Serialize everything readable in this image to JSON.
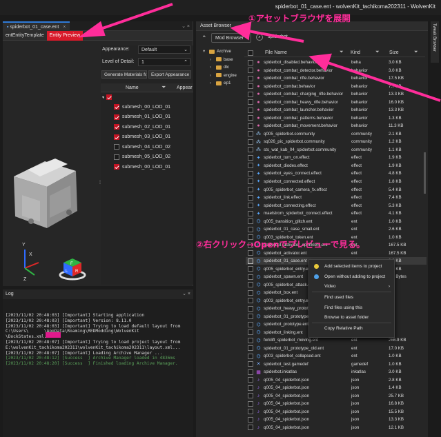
{
  "window": {
    "title": "spiderbot_01_case.ent - wolvenKit_tachikoma202311 - WolvenKit"
  },
  "left_panel": {
    "doc_tab": "spiderbot_01_case.ent",
    "subtabs": [
      "entEntityTemplate",
      "Entity Preview"
    ],
    "add_tab": "+",
    "appearance_label": "Appearance:",
    "appearance_value": "Default",
    "lod_label": "Level of Detail:",
    "lod_value": "1",
    "gen_button": "Generate Materials fo",
    "export_button": "Export Appearance w",
    "col_name": "Name",
    "col_appear": "Appear",
    "meshes": [
      {
        "name": "submesh_00_LOD_01",
        "checked": true
      },
      {
        "name": "submesh_01_LOD_01",
        "checked": true
      },
      {
        "name": "submesh_02_LOD_01",
        "checked": true
      },
      {
        "name": "submesh_03_LOD_01",
        "checked": true
      },
      {
        "name": "submesh_04_LOD_02",
        "checked": false
      },
      {
        "name": "submesh_05_LOD_02",
        "checked": false
      },
      {
        "name": "submesh_00_LOD_01",
        "checked": true
      }
    ],
    "axes": {
      "y": "Y",
      "x": "X",
      "z": "Z"
    },
    "gizmo_letters": [
      "L",
      "R",
      "F"
    ]
  },
  "log": {
    "title": "Log",
    "lines": [
      {
        "t": "[2023/11/02 20:48:03] [Important] Starting application",
        "green": false
      },
      {
        "t": "[2023/11/02 20:48:03] [Important] Version: 8.11.0",
        "green": false
      },
      {
        "t": "[2023/11/02 20:48:03] [Important] Trying to load default layout from",
        "green": false
      },
      {
        "t": "C:\\Users\\      \\AppData\\Roaming\\REDModding\\WolvenKit",
        "green": false
      },
      {
        "t": "\\DockStates.xml...",
        "green": false
      },
      {
        "t": "[2023/11/02 20:48:07] [Important] Trying to load project layout from",
        "green": false
      },
      {
        "t": "E:\\wolvenKit_tachikoma202311\\wolvenKit_tachikoma202311\\layout.xml...",
        "green": false
      },
      {
        "t": "[2023/11/02 20:48:07] [Important] Loading Archive Manager ...",
        "green": false
      },
      {
        "t": "[2023/11/02 20:48:12] [Success  ] Archive Manager loaded in 4836ms",
        "green": true
      },
      {
        "t": "[2023/11/02 20:48:20] [Success  ] Finished loading Archive Manager.",
        "green": true
      }
    ]
  },
  "asset_browser": {
    "title": "Asset Browser",
    "mod_browser": "Mod Browser",
    "search": "spiderbot",
    "tree": [
      "Archive",
      "base",
      "dlc",
      "engine",
      "ep1"
    ],
    "columns": {
      "name": "File Name",
      "kind": "Kind",
      "size": "Size"
    },
    "side_tab": "Tweak Browser",
    "files": [
      {
        "name": "spiderbot_disabled.behavior",
        "kind": "beha",
        "size": "3.0 KB",
        "icon": "behavior"
      },
      {
        "name": "spiderbot_combat_detector.behavior",
        "kind": "behavior",
        "size": "3.0 KB",
        "icon": "behavior"
      },
      {
        "name": "spiderbot_combat_rifle.behavior",
        "kind": "behavior",
        "size": "17.5 KB",
        "icon": "behavior"
      },
      {
        "name": "spiderbot_combat.behavior",
        "kind": "behavior",
        "size": "7.7 KB",
        "icon": "behavior"
      },
      {
        "name": "spiderbot_combat_charging_rifle.behavior",
        "kind": "behavior",
        "size": "13.3 KB",
        "icon": "behavior"
      },
      {
        "name": "spiderbot_combat_heavy_rifle.behavior",
        "kind": "behavior",
        "size": "16.0 KB",
        "icon": "behavior"
      },
      {
        "name": "spiderbot_combat_launcher.behavior",
        "kind": "behavior",
        "size": "13.3 KB",
        "icon": "behavior"
      },
      {
        "name": "spiderbot_combat_patterns.behavior",
        "kind": "behavior",
        "size": "1.3 KB",
        "icon": "behavior"
      },
      {
        "name": "spiderbot_combat_movement.behavior",
        "kind": "behavior",
        "size": "11.3 KB",
        "icon": "behavior"
      },
      {
        "name": "q005_spiderbot.community",
        "kind": "community",
        "size": "2.1 KB",
        "icon": "community"
      },
      {
        "name": "sq026_pic_spiderbot.community",
        "kind": "community",
        "size": "1.2 KB",
        "icon": "community"
      },
      {
        "name": "sts_wat_kab_04_spiderbot.community",
        "kind": "community",
        "size": "1.1 KB",
        "icon": "community"
      },
      {
        "name": "spiderbot_turn_on.effect",
        "kind": "effect",
        "size": "1.9 KB",
        "icon": "effect"
      },
      {
        "name": "spiderbot_diodes.effect",
        "kind": "effect",
        "size": "1.9 KB",
        "icon": "effect"
      },
      {
        "name": "spiderbot_eyes_connect.effect",
        "kind": "effect",
        "size": "4.8 KB",
        "icon": "effect"
      },
      {
        "name": "spiderbot_connected.effect",
        "kind": "effect",
        "size": "1.8 KB",
        "icon": "effect"
      },
      {
        "name": "q005_spiderbot_camera_fx.effect",
        "kind": "effect",
        "size": "5.4 KB",
        "icon": "effect"
      },
      {
        "name": "spiderbot_link.effect",
        "kind": "effect",
        "size": "7.4 KB",
        "icon": "effect"
      },
      {
        "name": "spiderbot_connecting.effect",
        "kind": "effect",
        "size": "5.3 KB",
        "icon": "effect"
      },
      {
        "name": "maelstrom_spiderbot_connect.effect",
        "kind": "effect",
        "size": "4.1 KB",
        "icon": "effect"
      },
      {
        "name": "q005_transition_glitch.ent",
        "kind": "ent",
        "size": "1.0 KB",
        "icon": "ent"
      },
      {
        "name": "spiderbot_01_case_small.ent",
        "kind": "ent",
        "size": "2.6 KB",
        "icon": "ent"
      },
      {
        "name": "q003_spiderbot_token.ent",
        "kind": "ent",
        "size": "1.0 KB",
        "icon": "ent"
      },
      {
        "name": "spiderbot_activator_sprinklers.ent",
        "kind": "ent",
        "size": "167.5 KB",
        "icon": "ent"
      },
      {
        "name": "spiderbot_activator.ent",
        "kind": "ent",
        "size": "167.5 KB",
        "icon": "ent"
      },
      {
        "name": "spiderbot_01_case.ent",
        "kind": "ent",
        "size": "2.6 KB",
        "icon": "ent",
        "selected": true
      },
      {
        "name": "q005_spiderbot_entry.ent",
        "kind": "ent",
        "size": "1.2 KB",
        "icon": "ent"
      },
      {
        "name": "spiderbot_spawn.ent",
        "kind": "ent",
        "size": "3.0 Bytes",
        "icon": "ent"
      },
      {
        "name": "q005_spiderbot_attack.ent",
        "kind": "ent",
        "size": "",
        "icon": "ent"
      },
      {
        "name": "spiderbot_box.ent",
        "kind": "ent",
        "size": "",
        "icon": "ent"
      },
      {
        "name": "q003_spiderbot_entry.ent",
        "kind": "ent",
        "size": "",
        "icon": "ent"
      },
      {
        "name": "spiderbot_heavy_prototype.ent",
        "kind": "ent",
        "size": "",
        "icon": "ent"
      },
      {
        "name": "spiderbot_01_prototype.ent",
        "kind": "ent",
        "size": "",
        "icon": "ent"
      },
      {
        "name": "spiderbot_prototype.ent",
        "kind": "ent",
        "size": "",
        "icon": "ent"
      },
      {
        "name": "spiderbot_linking.ent",
        "kind": "ent",
        "size": "",
        "icon": "ent"
      },
      {
        "name": "forklift_spiderbot_moving.ent",
        "kind": "ent",
        "size": "266.9 KB",
        "icon": "ent"
      },
      {
        "name": "spiderbot_01_prototype_old.ent",
        "kind": "ent",
        "size": "17.0 KB",
        "icon": "ent"
      },
      {
        "name": "q003_spiderbot_collapsed.ent",
        "kind": "ent",
        "size": "1.0 KB",
        "icon": "ent"
      },
      {
        "name": "spiderbot_test.gamedef",
        "kind": "gamedef",
        "size": "1.0 KB",
        "icon": "gamedef"
      },
      {
        "name": "spiderbot.inkatlas",
        "kind": "inkatlas",
        "size": "3.0 KB",
        "icon": "inkatlas"
      },
      {
        "name": "q005_04_spiderbot.json",
        "kind": "json",
        "size": "2.8 KB",
        "icon": "json"
      },
      {
        "name": "q005_04_spiderbot.json",
        "kind": "json",
        "size": "1.4 KB",
        "icon": "json"
      },
      {
        "name": "q005_04_spiderbot.json",
        "kind": "json",
        "size": "25.7 KB",
        "icon": "json"
      },
      {
        "name": "q005_04_spiderbot.json",
        "kind": "json",
        "size": "16.8 KB",
        "icon": "json"
      },
      {
        "name": "q005_04_spiderbot.json",
        "kind": "json",
        "size": "15.5 KB",
        "icon": "json"
      },
      {
        "name": "q005_04_spiderbot.json",
        "kind": "json",
        "size": "13.3 KB",
        "icon": "json"
      },
      {
        "name": "q005_04_spiderbot.json",
        "kind": "json",
        "size": "12.1 KB",
        "icon": "json"
      }
    ]
  },
  "context_menu": [
    {
      "label": "Add selected items to project",
      "icon": "add",
      "sub": false,
      "sep": false
    },
    {
      "label": "Open without adding to project",
      "icon": "open",
      "sub": false,
      "sep": false
    },
    {
      "label": "Video",
      "icon": "",
      "sub": true,
      "sep": true
    },
    {
      "label": "Find used files",
      "icon": "",
      "sub": false,
      "sep": false
    },
    {
      "label": "Find files using this",
      "icon": "",
      "sub": false,
      "sep": false
    },
    {
      "label": "Browse to asset folder",
      "icon": "",
      "sub": false,
      "sep": true
    },
    {
      "label": "Copy Relative Path",
      "icon": "",
      "sub": false,
      "sep": false
    }
  ],
  "annotations": {
    "top": "①アセットブラウザを展開",
    "mid": "②右クリック→Openでプレビューで見る。"
  },
  "colors": {
    "accent_red": "#d81a2a",
    "annotation_pink": "#ff2d9a"
  }
}
